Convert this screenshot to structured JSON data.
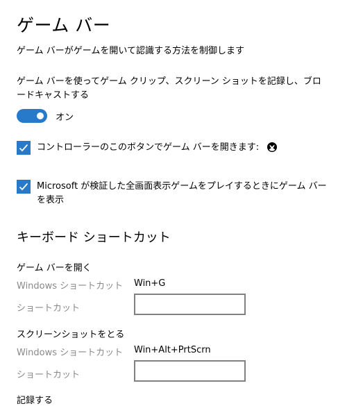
{
  "page": {
    "title": "ゲーム バー",
    "description": "ゲーム バーがゲームを開いて認識する方法を制御します"
  },
  "record": {
    "description": "ゲーム バーを使ってゲーム クリップ、スクリーン ショットを記録し、ブロードキャストする",
    "toggle_state": "オン",
    "toggle_on": true
  },
  "checkboxes": [
    {
      "label": "コントローラーのこのボタンでゲーム バーを開きます:",
      "checked": true,
      "icon": "xbox-icon"
    },
    {
      "label": "Microsoft が検証した全画面表示ゲームをプレイするときにゲーム バーを表示",
      "checked": true
    }
  ],
  "keyboard": {
    "section_title": "キーボード ショートカット",
    "groups": [
      {
        "title": "ゲーム バーを開く",
        "windows_label": "Windows ショートカット",
        "windows_value": "Win+G",
        "custom_label": "ショートカット",
        "custom_value": ""
      },
      {
        "title": "スクリーンショットをとる",
        "windows_label": "Windows ショートカット",
        "windows_value": "Win+Alt+PrtScrn",
        "custom_label": "ショートカット",
        "custom_value": ""
      }
    ],
    "next_group_title_partial": "記録する"
  },
  "colors": {
    "accent": "#2779c9",
    "secondary_text": "#8a8a8a",
    "input_border": "#808080"
  }
}
